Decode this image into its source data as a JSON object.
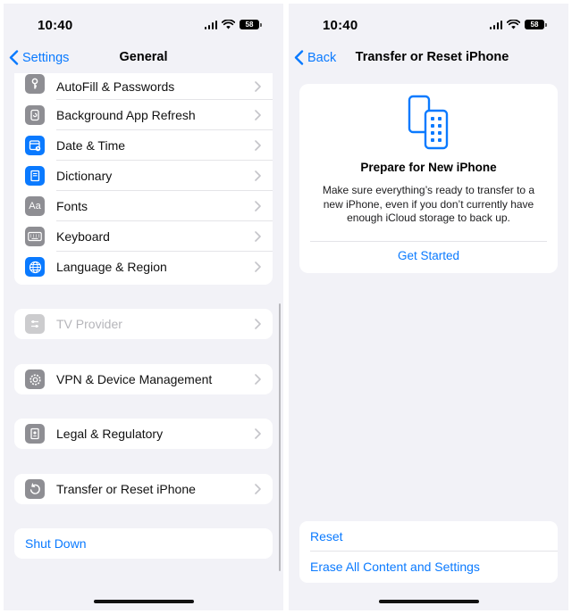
{
  "colors": {
    "accent": "#0a7aff",
    "gray_icon": "#8e8e93",
    "blue_icon": "#0a7aff",
    "background": "#f2f2f7"
  },
  "left": {
    "status": {
      "time": "10:40",
      "battery": "58"
    },
    "nav": {
      "back_label": "Settings",
      "title": "General"
    },
    "group1": [
      {
        "label": "AutoFill & Passwords",
        "icon": "key-icon"
      },
      {
        "label": "Background App Refresh",
        "icon": "refresh-icon"
      },
      {
        "label": "Date & Time",
        "icon": "calendar-clock-icon"
      },
      {
        "label": "Dictionary",
        "icon": "book-icon"
      },
      {
        "label": "Fonts",
        "icon": "fonts-icon",
        "glyph": "Aa"
      },
      {
        "label": "Keyboard",
        "icon": "keyboard-icon"
      },
      {
        "label": "Language & Region",
        "icon": "globe-icon"
      }
    ],
    "tv_provider": {
      "label": "TV Provider",
      "icon": "tv-provider-icon"
    },
    "vpn": {
      "label": "VPN & Device Management",
      "icon": "gear-icon"
    },
    "legal": {
      "label": "Legal & Regulatory",
      "icon": "document-icon"
    },
    "transfer": {
      "label": "Transfer or Reset iPhone",
      "icon": "reset-icon"
    },
    "shut_down": "Shut Down"
  },
  "right": {
    "status": {
      "time": "10:40",
      "battery": "58"
    },
    "nav": {
      "back_label": "Back",
      "title": "Transfer or Reset iPhone"
    },
    "card": {
      "title": "Prepare for New iPhone",
      "description": "Make sure everything’s ready to transfer to a new iPhone, even if you don’t currently have enough iCloud storage to back up.",
      "action": "Get Started"
    },
    "reset": "Reset",
    "erase": "Erase All Content and Settings"
  }
}
